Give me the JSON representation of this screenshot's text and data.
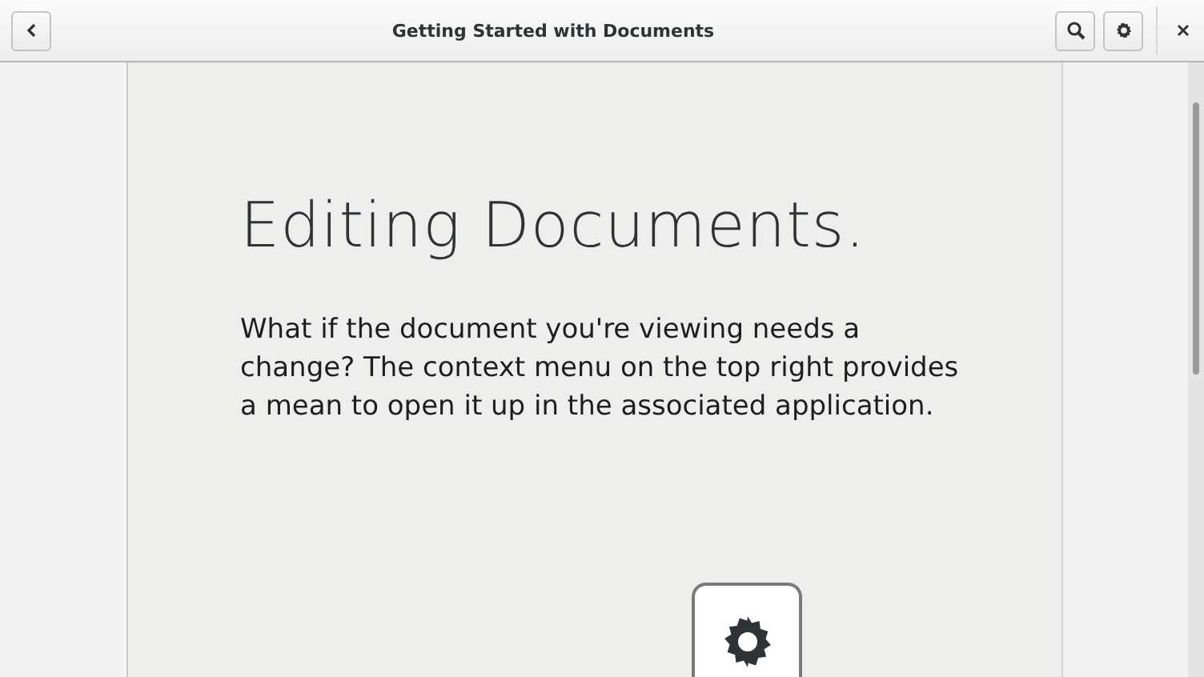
{
  "window": {
    "title": "Getting Started with Documents"
  },
  "page": {
    "heading": "Editing Documents.",
    "body": "What if the document you're viewing needs a change? The context menu on the top right provides a mean to open it up in the associated application."
  }
}
